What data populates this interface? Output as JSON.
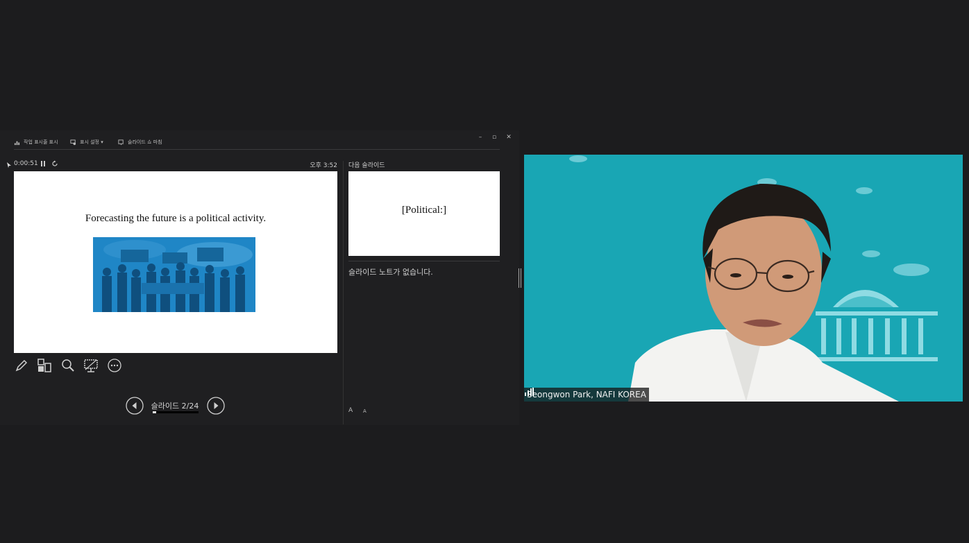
{
  "toolbar": {
    "taskbar_label": "작업 표시줄 표시",
    "display_settings_label": "표시 설정 ▾",
    "end_show_label": "슬라이드 쇼 마침"
  },
  "window": {
    "minimize": "–",
    "restore": "▫",
    "close": "✕"
  },
  "presenter": {
    "timer": "0:00:51",
    "clock": "오후 3:52",
    "current_slide_title": "Forecasting the future is a political activity.",
    "slide_counter": "슬라이드 2/24",
    "slide_progress": 0.083,
    "next_slide_label": "다음 슬라이드",
    "next_slide_title": "[Political:]",
    "notes_text": "슬라이드 노트가 없습니다.",
    "font_increase": "A",
    "font_decrease": "A"
  },
  "tools": [
    "pen-icon",
    "grid-icon",
    "zoom-icon",
    "screen-icon",
    "more-icon"
  ],
  "video": {
    "participant_name": "Seongwon Park, NAFI KOREA",
    "bg_color": "#19a6b4"
  }
}
